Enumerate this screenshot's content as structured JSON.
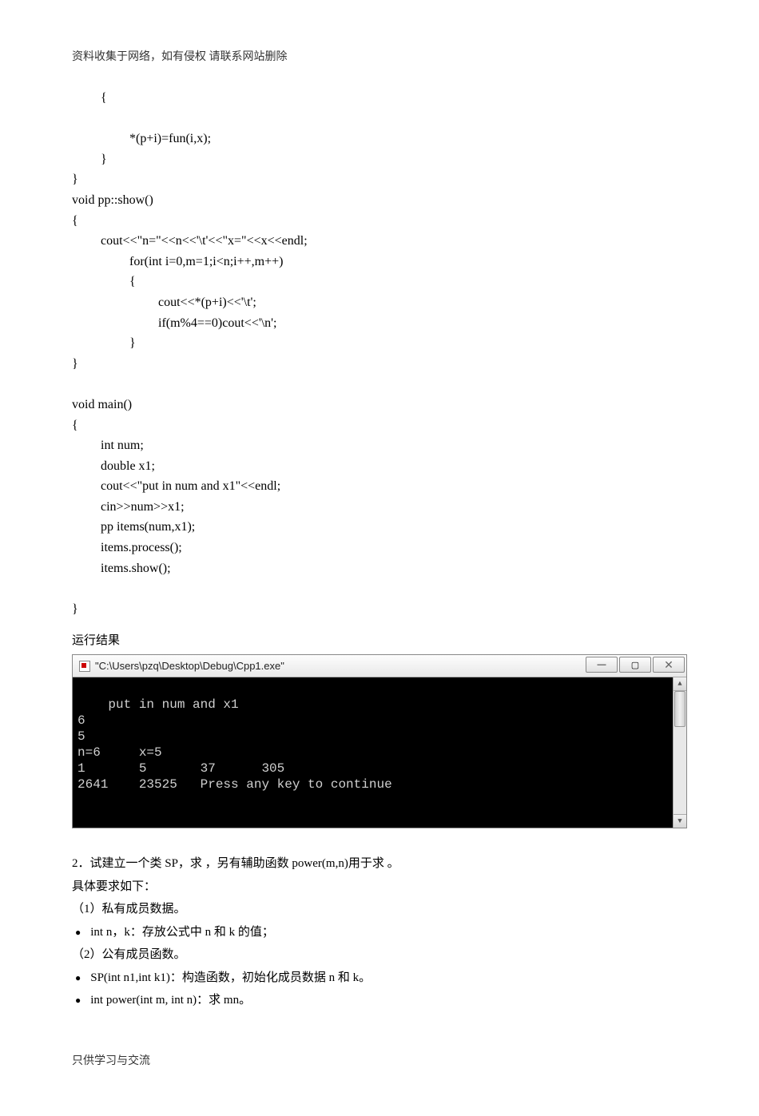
{
  "header": "资料收集于网络，如有侵权 请联系网站删除",
  "code": [
    {
      "cls": "indent1",
      "text": "{"
    },
    {
      "cls": "",
      "text": ""
    },
    {
      "cls": "indent2",
      "text": "*(p+i)=fun(i,x);"
    },
    {
      "cls": "indent1",
      "text": "}"
    },
    {
      "cls": "",
      "text": "}"
    },
    {
      "cls": "",
      "text": "void pp::show()"
    },
    {
      "cls": "",
      "text": "{"
    },
    {
      "cls": "indent1",
      "text": "cout<<\"n=\"<<n<<'\\t'<<\"x=\"<<x<<endl;"
    },
    {
      "cls": "indent2",
      "text": "for(int i=0,m=1;i<n;i++,m++)"
    },
    {
      "cls": "indent2",
      "text": "{"
    },
    {
      "cls": "indent3",
      "text": "cout<<*(p+i)<<'\\t';"
    },
    {
      "cls": "indent3",
      "text": "if(m%4==0)cout<<'\\n';"
    },
    {
      "cls": "indent2",
      "text": "}"
    },
    {
      "cls": "",
      "text": "}"
    },
    {
      "cls": "",
      "text": ""
    },
    {
      "cls": "",
      "text": "void main()"
    },
    {
      "cls": "",
      "text": "{"
    },
    {
      "cls": "indent1",
      "text": "int num;"
    },
    {
      "cls": "indent1",
      "text": "double x1;"
    },
    {
      "cls": "indent1",
      "text": "cout<<\"put in num and x1\"<<endl;"
    },
    {
      "cls": "indent1",
      "text": "cin>>num>>x1;"
    },
    {
      "cls": "indent1",
      "text": "pp items(num,x1);"
    },
    {
      "cls": "indent1",
      "text": "items.process();"
    },
    {
      "cls": "indent1",
      "text": "items.show();"
    },
    {
      "cls": "",
      "text": ""
    },
    {
      "cls": "",
      "text": "}"
    }
  ],
  "run_label": "运行结果",
  "console": {
    "title": "\"C:\\Users\\pzq\\Desktop\\Debug\\Cpp1.exe\"",
    "output": "put in num and x1\n6\n5\nn=6     x=5\n1       5       37      305\n2641    23525   Press any key to continue"
  },
  "question": {
    "q_line": "2．试建立一个类 SP，求  ，另有辅助函数 power(m,n)用于求  。",
    "req_label": "具体要求如下：",
    "sec1": "（1）私有成员数据。",
    "b1": "int n，k：存放公式中 n 和 k 的值；",
    "sec2": "（2）公有成员函数。",
    "b2": "SP(int n1,int k1)：构造函数，初始化成员数据 n 和 k。",
    "b3": "int power(int m, int n)：求 mn。"
  },
  "footer": "只供学习与交流",
  "buttons": {
    "min": "—",
    "max": "▢",
    "close": "✕"
  }
}
